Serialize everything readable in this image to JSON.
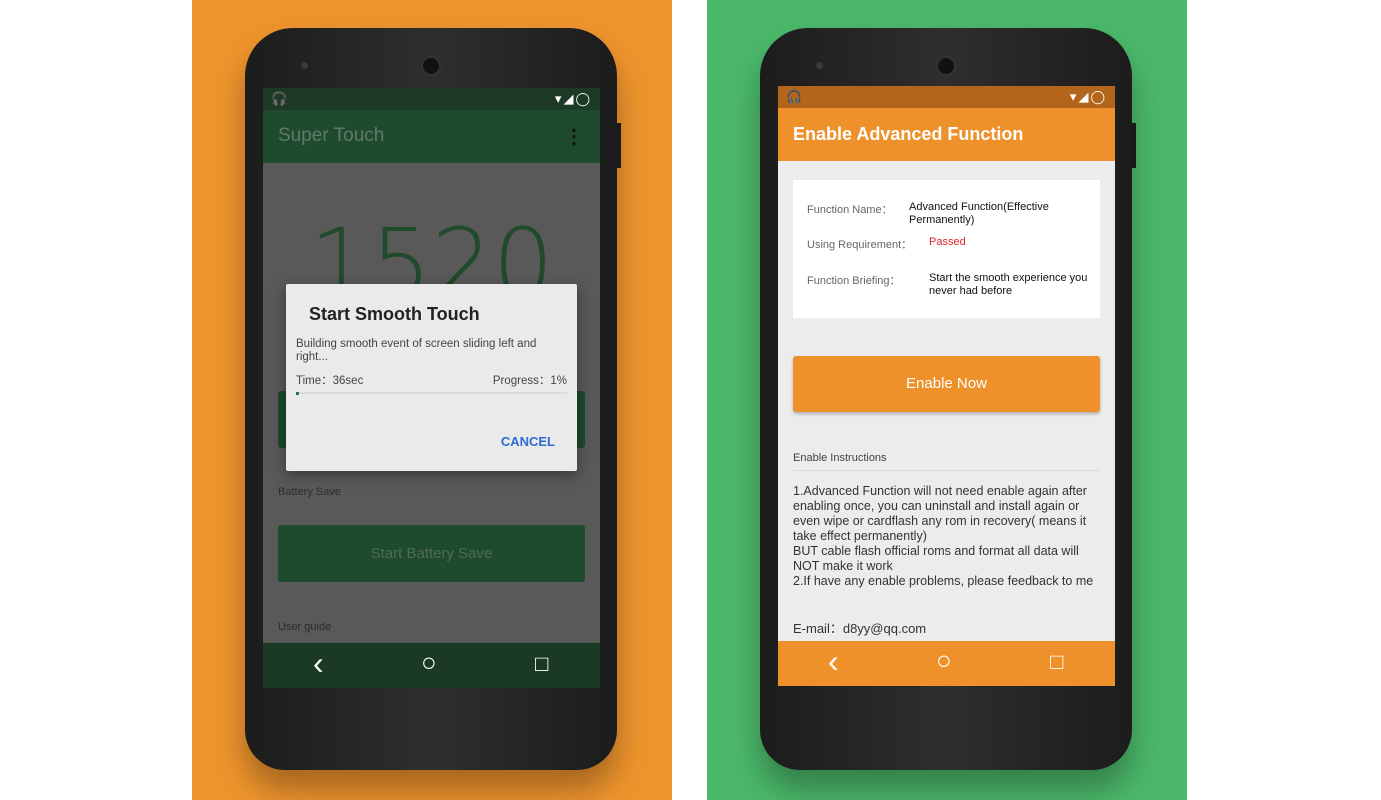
{
  "left": {
    "bg": "#ee942d",
    "status": {
      "left_icon": "headphones-icon",
      "right_icons": "▾◢◯"
    },
    "app_title": "Super Touch",
    "menu_icon": "⋮",
    "score": "1520",
    "dialog": {
      "title": "Start Smooth Touch",
      "message": "Building smooth event of screen sliding left and right...",
      "time_label": "Time：",
      "time_value": "36sec",
      "progress_label": "Progress：",
      "progress_value": "1%",
      "progress": 0.01,
      "cancel": "CANCEL"
    },
    "battery_label": "Battery Save",
    "battery_button": "Start Battery Save",
    "user_guide": "User guide",
    "nav": {
      "back": "‹",
      "home": "○",
      "recent": "□"
    }
  },
  "right": {
    "bg": "#4bb86a",
    "accent": "#ef912b",
    "status": {
      "right_icons": "▾◢◯"
    },
    "app_title": "Enable Advanced Function",
    "info": [
      {
        "label": "Function Name：",
        "value": "Advanced Function(Effective Permanently)"
      },
      {
        "label": "Using Requirement：",
        "value": "Passed"
      },
      {
        "label": "Function Briefing：",
        "value": "Start the smooth experience you never had before"
      }
    ],
    "enable_button": "Enable Now",
    "instructions_title": "Enable Instructions",
    "instructions": "1.Advanced Function will not need enable again after enabling once, you can uninstall and install again or even wipe or cardflash any rom in recovery( means it take effect permanently)\nBUT cable flash official roms and format all data will NOT make it work\n2.If have any enable problems, please feedback to me",
    "email_label": "E-mail：",
    "email": "d8yy@qq.com",
    "nav": {
      "back": "‹",
      "home": "○",
      "recent": "□"
    }
  }
}
